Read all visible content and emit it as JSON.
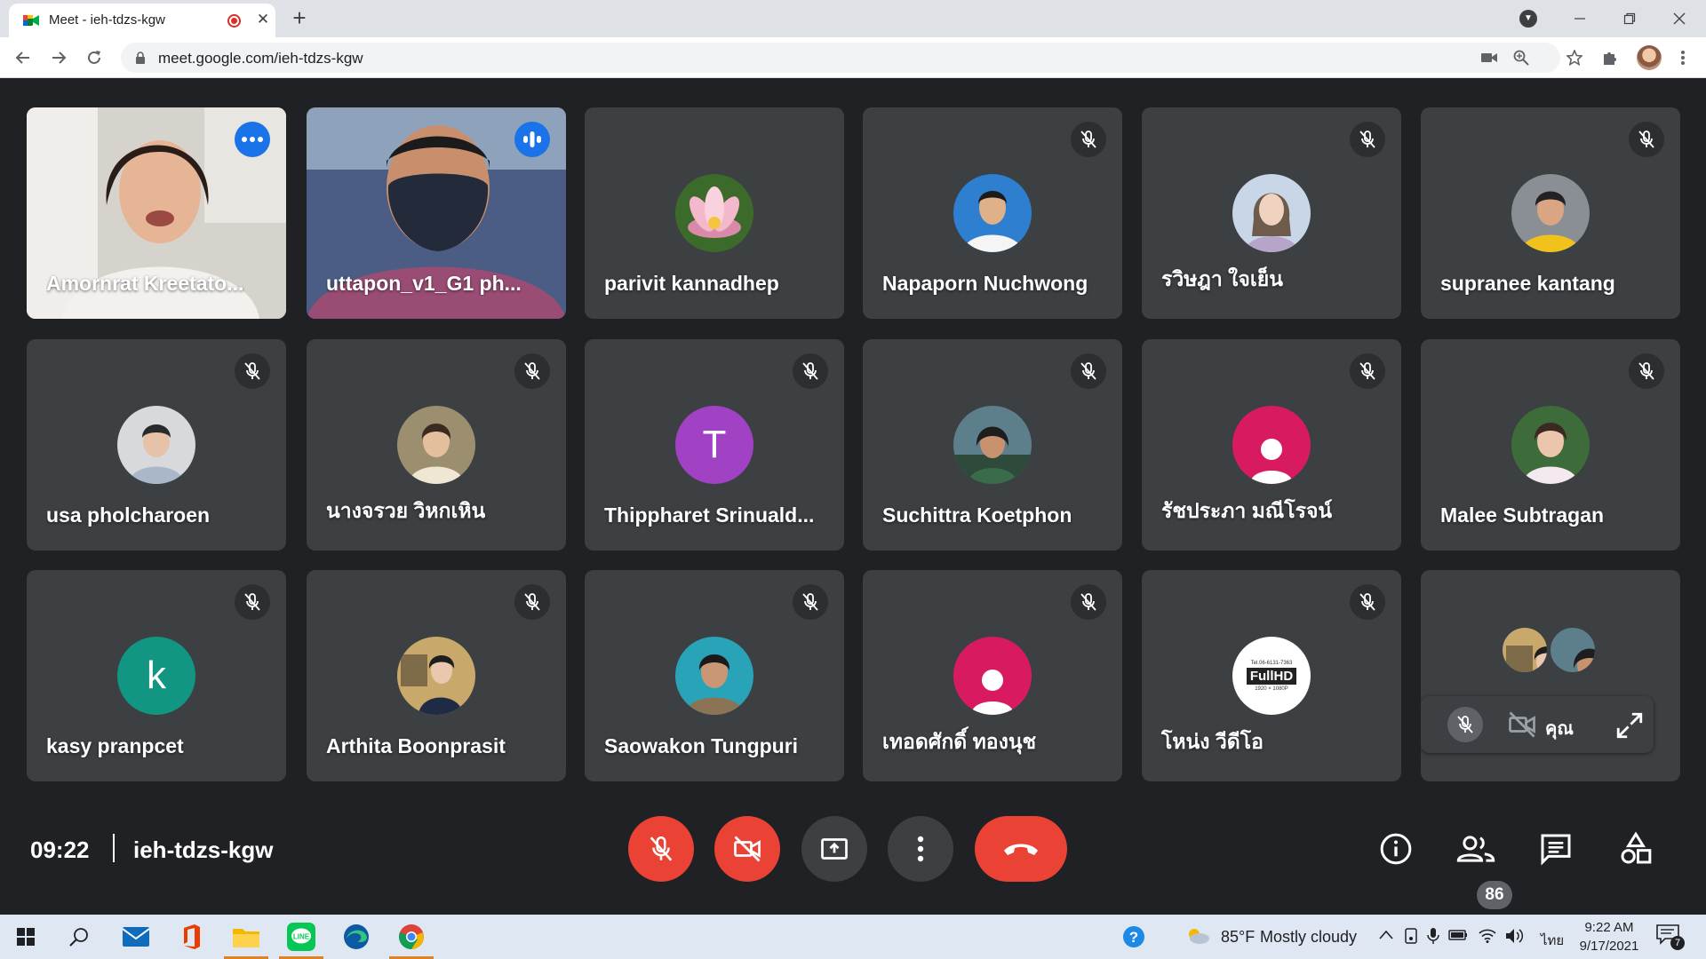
{
  "browser": {
    "tab_title": "Meet - ieh-tdzs-kgw",
    "url": "meet.google.com/ieh-tdzs-kgw",
    "new_tab": "+",
    "tab_close": "✕"
  },
  "meeting": {
    "time": "09:22",
    "code": "ieh-tdzs-kgw",
    "participant_count": "86",
    "self_label": "คุณ"
  },
  "participants": [
    {
      "name": "Amornrat Kreetato...",
      "type": "video",
      "badge": "more",
      "active": true
    },
    {
      "name": "uttapon_v1_G1 ph...",
      "type": "video",
      "badge": "speaking"
    },
    {
      "name": "parivit kannadhep",
      "type": "photo",
      "badge": "none",
      "avatar": "lotus"
    },
    {
      "name": "Napaporn Nuchwong",
      "type": "photo",
      "badge": "muted",
      "avatar": "person-uniform"
    },
    {
      "name": "รวิษฎา ใจเย็น",
      "type": "photo",
      "badge": "muted",
      "avatar": "person-light"
    },
    {
      "name": "supranee kantang",
      "type": "photo",
      "badge": "muted",
      "avatar": "person-yellow"
    },
    {
      "name": "usa pholcharoen",
      "type": "photo",
      "badge": "muted",
      "avatar": "person-grey"
    },
    {
      "name": "นางจรวย วิหกเหิน",
      "type": "photo",
      "badge": "muted",
      "avatar": "person-beige"
    },
    {
      "name": "Thippharet Srinuald...",
      "type": "letter",
      "badge": "muted",
      "letter": "T",
      "color": "#a142c4"
    },
    {
      "name": "Suchittra Koetphon",
      "type": "photo",
      "badge": "muted",
      "avatar": "person-outdoor"
    },
    {
      "name": "รัชประภา มณีโรจน์",
      "type": "default",
      "badge": "muted",
      "color": "#d81b60"
    },
    {
      "name": "Malee Subtragan",
      "type": "photo",
      "badge": "muted",
      "avatar": "person-green"
    },
    {
      "name": "kasy pranpcet",
      "type": "letter",
      "badge": "muted",
      "letter": "k",
      "color": "#129683"
    },
    {
      "name": "Arthita Boonprasit",
      "type": "photo",
      "badge": "muted",
      "avatar": "person-office"
    },
    {
      "name": "Saowakon Tungpuri",
      "type": "photo",
      "badge": "muted",
      "avatar": "person-teal"
    },
    {
      "name": "เทอดศักดิ์ ทองนุช",
      "type": "default",
      "badge": "muted",
      "color": "#d81b60"
    },
    {
      "name": "โหน่ง วีดีโอ",
      "type": "photo",
      "badge": "muted",
      "avatar": "fullhd-logo"
    },
    {
      "name": "",
      "type": "self",
      "badge": "none"
    }
  ],
  "logo_text": {
    "fullhd": "FullHD",
    "phone": "Tel.06-6131-7363",
    "res": "1920 × 1080P"
  },
  "taskbar": {
    "weather_temp": "85°F",
    "weather_desc": "Mostly cloudy",
    "lang": "ไทย",
    "time": "9:22 AM",
    "date": "9/17/2021",
    "notifications": "7"
  },
  "colors": {
    "tile_bg": "#3c4043",
    "stage_bg": "#202124",
    "active_outline": "#8ab4f8",
    "red": "#ea4335",
    "blue_badge": "#1a73e8"
  }
}
